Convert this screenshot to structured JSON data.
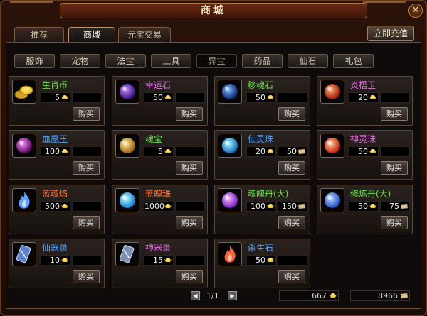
{
  "window": {
    "title": "商城",
    "close_label": "✕"
  },
  "main_tabs": [
    {
      "label": "推荐"
    },
    {
      "label": "商城"
    },
    {
      "label": "元宝交易"
    }
  ],
  "recharge_label": "立即充值",
  "sub_tabs": [
    {
      "label": "服饰"
    },
    {
      "label": "宠物"
    },
    {
      "label": "法宝"
    },
    {
      "label": "工具"
    },
    {
      "label": "异宝"
    },
    {
      "label": "药品"
    },
    {
      "label": "仙石"
    },
    {
      "label": "礼包"
    }
  ],
  "active_main_tab": 1,
  "active_sub_tab": 4,
  "buy_label": "购买",
  "items": [
    {
      "name": "生肖币",
      "color": "#6ae04a",
      "price": "5",
      "price2": "",
      "icon": "gold-coins-icon"
    },
    {
      "name": "幸运石",
      "color": "#e070e0",
      "price": "50",
      "price2": "",
      "icon": "lucky-stone-icon"
    },
    {
      "name": "移魂石",
      "color": "#6ae04a",
      "price": "50",
      "price2": "",
      "icon": "soul-stone-icon"
    },
    {
      "name": "炎梧玉",
      "color": "#e070e0",
      "price": "20",
      "price2": "",
      "icon": "flame-jade-icon"
    },
    {
      "name": "血凰玉",
      "color": "#50a8ff",
      "price": "100",
      "price2": "",
      "icon": "blood-jade-icon"
    },
    {
      "name": "魂宝",
      "color": "#6ae04a",
      "price": "5",
      "price2": "",
      "icon": "soul-treasure-icon"
    },
    {
      "name": "仙灵珠",
      "color": "#50a8ff",
      "price": "20",
      "price2": "50",
      "icon": "spirit-pearl-icon"
    },
    {
      "name": "神灵珠",
      "color": "#e070e0",
      "price": "50",
      "price2": "",
      "icon": "divine-pearl-icon"
    },
    {
      "name": "蓝魂焰",
      "color": "#ff7a3a",
      "price": "500",
      "price2": "",
      "icon": "blue-flame-icon"
    },
    {
      "name": "蓝魄珠",
      "color": "#ff7a3a",
      "price": "1000",
      "price2": "",
      "icon": "blue-orb-icon"
    },
    {
      "name": "魂魄丹(大)",
      "color": "#6ae04a",
      "price": "100",
      "price2": "150",
      "icon": "soul-pill-icon"
    },
    {
      "name": "修炼丹(大)",
      "color": "#6ae04a",
      "price": "50",
      "price2": "75",
      "icon": "training-pill-icon"
    },
    {
      "name": "仙器录",
      "color": "#50a8ff",
      "price": "10",
      "price2": "",
      "icon": "immortal-scroll-icon"
    },
    {
      "name": "神器录",
      "color": "#e070e0",
      "price": "15",
      "price2": "",
      "icon": "divine-scroll-icon"
    },
    {
      "name": "杀生石",
      "color": "#50a8ff",
      "price": "50",
      "price2": "",
      "icon": "kill-stone-icon"
    }
  ],
  "pager": {
    "text": "1/1",
    "prev": "◀",
    "next": "▶"
  },
  "balance": {
    "ingots": "667",
    "tickets": "8966"
  }
}
